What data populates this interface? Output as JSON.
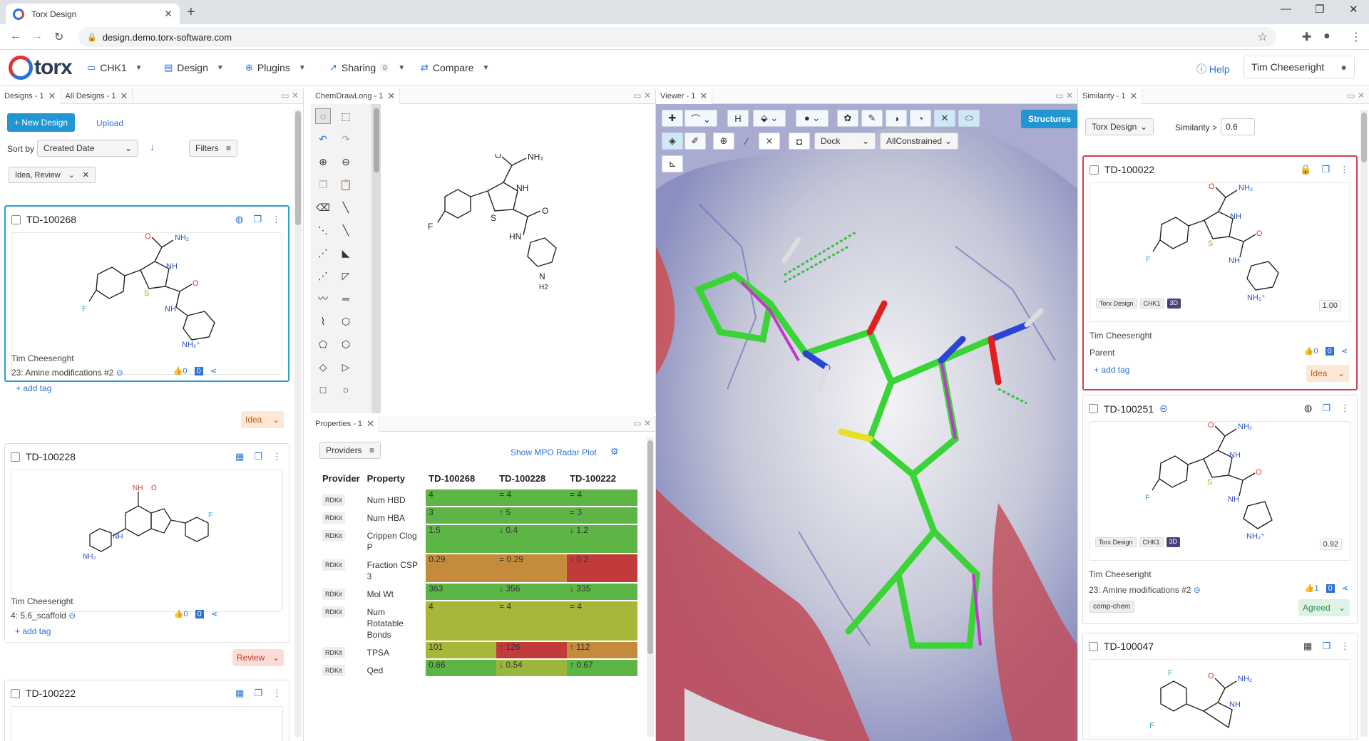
{
  "browser": {
    "tab_title": "Torx Design",
    "url": "design.demo.torx-software.com"
  },
  "app": {
    "logo_text": "torx",
    "menus": [
      {
        "label": "CHK1",
        "icon": "folder-icon"
      },
      {
        "label": "Design",
        "icon": "design-icon"
      },
      {
        "label": "Plugins",
        "icon": "plugin-icon"
      },
      {
        "label": "Sharing",
        "icon": "share-icon",
        "count": "0"
      },
      {
        "label": "Compare",
        "icon": "compare-icon"
      }
    ],
    "help": "Help",
    "user": "Tim Cheeseright"
  },
  "designs_panel": {
    "tabs": [
      "Designs - 1",
      "All Designs - 1"
    ],
    "new_design": "New Design",
    "upload": "Upload",
    "sort_by_label": "Sort by",
    "sort_value": "Created Date",
    "filters": "Filters",
    "filter_chip": "Idea, Review",
    "cards": [
      {
        "id": "TD-100268",
        "author": "Tim Cheeseright",
        "project": "23: Amine modifications #2",
        "add_tag": "+ add tag",
        "likes": "0",
        "comments": "0",
        "status": "Idea"
      },
      {
        "id": "TD-100228",
        "author": "Tim Cheeseright",
        "project": "4: 5,6_scaffold",
        "add_tag": "+ add tag",
        "likes": "0",
        "comments": "0",
        "status": "Review"
      },
      {
        "id": "TD-100222"
      }
    ]
  },
  "chemdraw_panel": {
    "tab": "ChemDrawLong - 1"
  },
  "properties_panel": {
    "tab": "Properties - 1",
    "providers": "Providers",
    "mpo": "Show MPO Radar Plot",
    "headers": [
      "Provider",
      "Property",
      "TD-100268",
      "TD-100228",
      "TD-100222"
    ],
    "rows": [
      {
        "provider": "RDKit",
        "property": "Num HBD",
        "v": [
          "4",
          "= 4",
          "= 4"
        ],
        "c": [
          "g",
          "g",
          "g"
        ]
      },
      {
        "provider": "RDKit",
        "property": "Num HBA",
        "v": [
          "3",
          "↑ 5",
          "= 3"
        ],
        "c": [
          "g",
          "g",
          "g"
        ]
      },
      {
        "provider": "RDKit",
        "property": "Crippen Clog P",
        "v": [
          "1.5",
          "↓ 0.4",
          "↓ 1.2"
        ],
        "c": [
          "g",
          "g",
          "g"
        ]
      },
      {
        "provider": "RDKit",
        "property": "Fraction CSP 3",
        "v": [
          "0.29",
          "= 0.29",
          "↓ 0.2"
        ],
        "c": [
          "o",
          "o",
          "r"
        ]
      },
      {
        "provider": "RDKit",
        "property": "Mol Wt",
        "v": [
          "363",
          "↓ 356",
          "↓ 335"
        ],
        "c": [
          "g",
          "g",
          "g"
        ]
      },
      {
        "provider": "RDKit",
        "property": "Num Rotatable Bonds",
        "v": [
          "4",
          "= 4",
          "= 4"
        ],
        "c": [
          "yg",
          "yg",
          "yg"
        ]
      },
      {
        "provider": "RDKit",
        "property": "TPSA",
        "v": [
          "101",
          "↑ 126",
          "↑ 112"
        ],
        "c": [
          "yg",
          "r",
          "o"
        ]
      },
      {
        "provider": "RDKit",
        "property": "Qed",
        "v": [
          "0.66",
          "↓ 0.54",
          "↑ 0.67"
        ],
        "c": [
          "g",
          "lg",
          "g"
        ]
      }
    ]
  },
  "viewer_panel": {
    "tab": "Viewer - 1",
    "structures": "Structures",
    "dock": "Dock",
    "constraint": "AllConstrained"
  },
  "similarity_panel": {
    "tab": "Similarity - 1",
    "source": "Torx Design",
    "threshold_label": "Similarity >",
    "threshold": "0.6",
    "cards": [
      {
        "id": "TD-100022",
        "chips": [
          "Torx Design",
          "CHK1",
          "3D"
        ],
        "score": "1.00",
        "author": "Tim Cheeseright",
        "relation": "Parent",
        "add_tag": "+ add tag",
        "likes": "0",
        "comments": "0",
        "status": "Idea"
      },
      {
        "id": "TD-100251",
        "chips": [
          "Torx Design",
          "CHK1",
          "3D"
        ],
        "score": "0.92",
        "author": "Tim Cheeseright",
        "relation": "23: Amine modifications #2",
        "tag": "comp-chem",
        "likes": "1",
        "comments": "0",
        "status": "Agreed"
      },
      {
        "id": "TD-100047"
      }
    ]
  }
}
